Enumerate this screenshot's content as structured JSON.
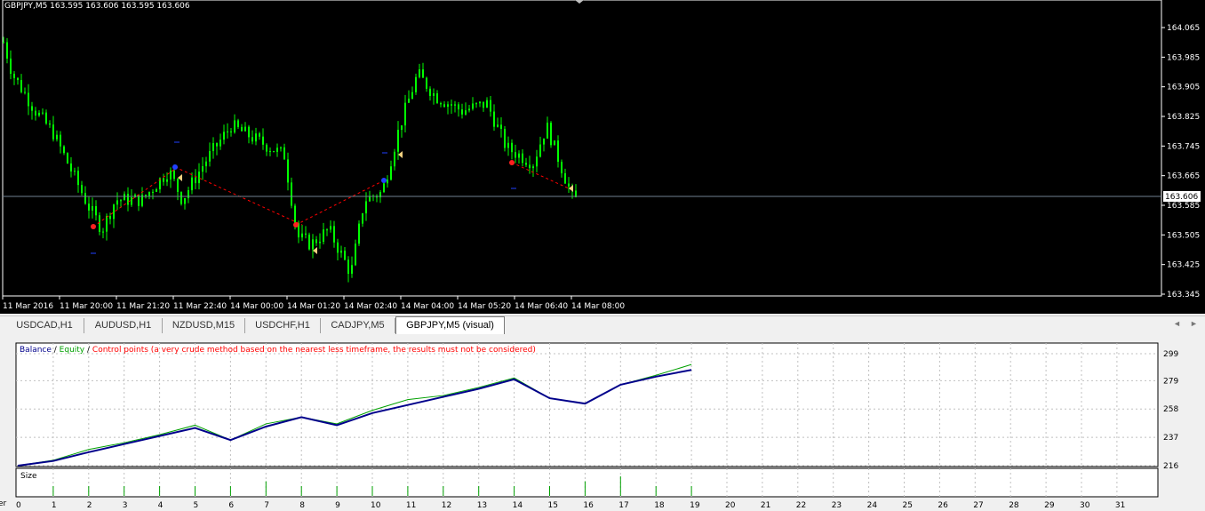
{
  "price_chart": {
    "header": "GBPJPY,M5  163.595 163.606 163.595 163.606",
    "current_price": "163.606",
    "price_axis": [
      "164.065",
      "163.985",
      "163.905",
      "163.825",
      "163.745",
      "163.665",
      "163.585",
      "163.505",
      "163.425",
      "163.345"
    ],
    "time_axis": [
      "11 Mar 2016",
      "11 Mar 20:00",
      "11 Mar 21:20",
      "11 Mar 22:40",
      "14 Mar 00:00",
      "14 Mar 01:20",
      "14 Mar 02:40",
      "14 Mar 04:00",
      "14 Mar 05:20",
      "14 Mar 06:40",
      "14 Mar 08:00"
    ],
    "colors": {
      "background": "#000000",
      "candle": "#00ff00",
      "bid_line": "#708090",
      "text": "#ffffff"
    }
  },
  "tabs": {
    "items": [
      "USDCAD,H1",
      "AUDUSD,H1",
      "NZDUSD,M15",
      "USDCHF,H1",
      "CADJPY,M5",
      "GBPJPY,M5 (visual)"
    ],
    "active_index": 5,
    "nav_left_icon": "◄",
    "nav_right_icon": "►"
  },
  "graph": {
    "legend": {
      "balance": "Balance",
      "sep1": " / ",
      "equity": "Equity",
      "sep2": " / ",
      "control": "Control points (a very crude method based on the nearest less timeframe, the results must not be considered)"
    },
    "size_label": "Size",
    "y_ticks": [
      "299",
      "279",
      "258",
      "237",
      "216"
    ],
    "x_ticks": [
      "0",
      "1",
      "2",
      "3",
      "4",
      "5",
      "6",
      "7",
      "8",
      "9",
      "10",
      "11",
      "12",
      "13",
      "14",
      "15",
      "16",
      "17",
      "18",
      "19",
      "20",
      "21",
      "22",
      "23",
      "24",
      "25",
      "26",
      "27",
      "28",
      "29",
      "30",
      "31"
    ],
    "colors": {
      "balance": "#00008b",
      "equity": "#00a000",
      "control": "#ff0000",
      "size_bar": "#00a000"
    },
    "side_label": "er"
  },
  "chart_data": [
    {
      "type": "line",
      "title": "Balance / Equity",
      "xlabel": "",
      "ylabel": "",
      "ylim": [
        212,
        303
      ],
      "series": [
        {
          "name": "Balance",
          "x": [
            0,
            1,
            2,
            3,
            4,
            5,
            6,
            7,
            8,
            9,
            10,
            11,
            12,
            13,
            14,
            15,
            16,
            17,
            18,
            19
          ],
          "values": [
            216,
            219.5,
            226,
            232,
            238,
            244,
            235,
            245,
            252,
            246,
            255,
            261,
            267,
            273,
            280,
            266,
            262,
            276,
            282,
            287
          ]
        },
        {
          "name": "Equity",
          "x": [
            0,
            1,
            2,
            3,
            4,
            5,
            6,
            7,
            8,
            9,
            10,
            11,
            12,
            13,
            14,
            15,
            16,
            17,
            18,
            19
          ],
          "values": [
            216,
            220,
            228,
            233,
            239,
            246,
            235,
            247,
            252,
            247,
            257,
            265,
            268,
            274,
            281,
            266,
            262,
            276,
            283,
            291
          ]
        }
      ]
    },
    {
      "type": "bar",
      "title": "Size",
      "categories": [
        "1",
        "2",
        "3",
        "4",
        "5",
        "6",
        "7",
        "8",
        "9",
        "10",
        "11",
        "12",
        "13",
        "14",
        "15",
        "16",
        "17",
        "18",
        "19"
      ],
      "values": [
        1,
        1,
        1,
        1,
        1,
        1,
        1.5,
        1,
        1,
        1,
        1,
        1,
        1,
        1,
        1,
        1.5,
        2,
        1,
        1
      ]
    }
  ]
}
